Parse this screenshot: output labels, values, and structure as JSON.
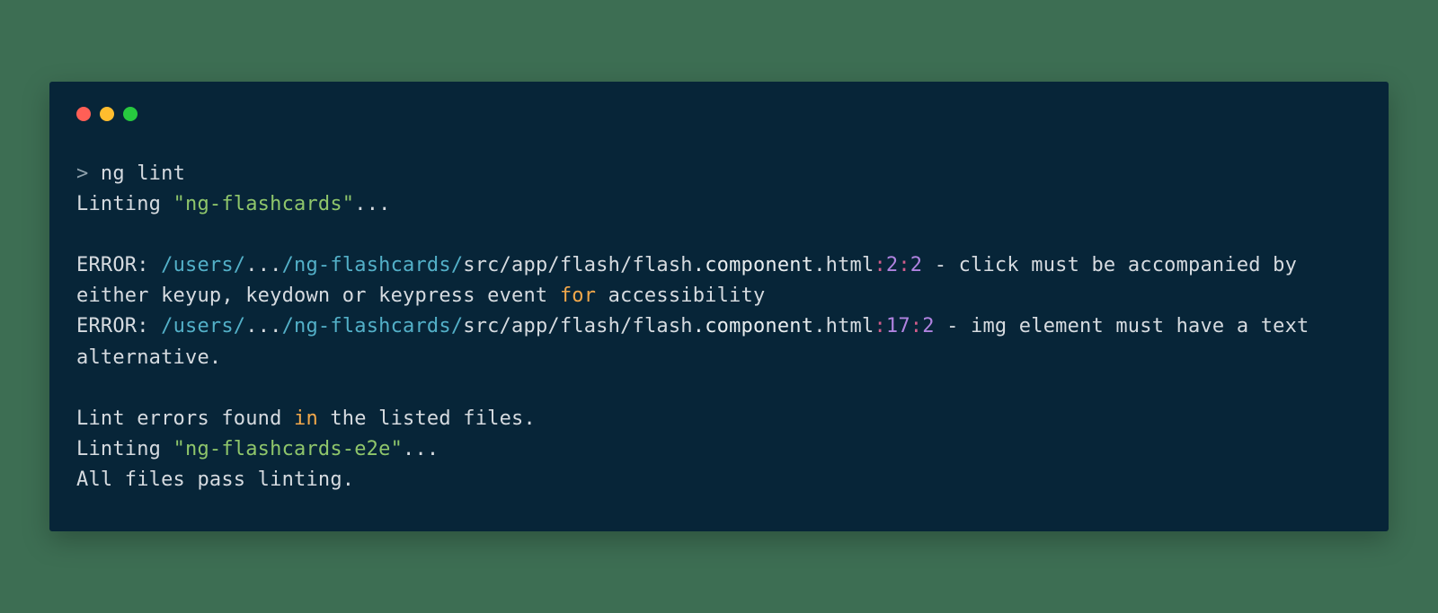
{
  "terminal": {
    "traffic_lights": [
      "close",
      "minimize",
      "zoom"
    ],
    "lines": [
      {
        "segments": [
          {
            "text": "> ",
            "cls": "c-dim"
          },
          {
            "text": "ng ",
            "cls": "c-default"
          },
          {
            "text": "lint",
            "cls": "c-default"
          }
        ]
      },
      {
        "segments": [
          {
            "text": "Linting ",
            "cls": "c-default"
          },
          {
            "text": "\"ng-flashcards\"",
            "cls": "c-green"
          },
          {
            "text": "...",
            "cls": "c-default"
          }
        ]
      },
      {
        "segments": [
          {
            "text": " ",
            "cls": "c-default"
          }
        ]
      },
      {
        "segments": [
          {
            "text": "ERROR: ",
            "cls": "c-default"
          },
          {
            "text": "/users/",
            "cls": "c-cyan"
          },
          {
            "text": "...",
            "cls": "c-default"
          },
          {
            "text": "/ng-flashcards/",
            "cls": "c-cyan"
          },
          {
            "text": "src/app/flash/flash",
            "cls": "c-default"
          },
          {
            "text": ".component",
            "cls": "c-white"
          },
          {
            "text": ".html",
            "cls": "c-default"
          },
          {
            "text": ":",
            "cls": "c-magenta"
          },
          {
            "text": "2",
            "cls": "c-purple"
          },
          {
            "text": ":",
            "cls": "c-magenta"
          },
          {
            "text": "2",
            "cls": "c-purple"
          },
          {
            "text": " - click must be accompanied by either keyup, keydown or keypress event ",
            "cls": "c-default"
          },
          {
            "text": "for",
            "cls": "c-orange"
          },
          {
            "text": " accessibility",
            "cls": "c-default"
          }
        ]
      },
      {
        "segments": [
          {
            "text": "ERROR: ",
            "cls": "c-default"
          },
          {
            "text": "/users/",
            "cls": "c-cyan"
          },
          {
            "text": "...",
            "cls": "c-default"
          },
          {
            "text": "/ng-flashcards/",
            "cls": "c-cyan"
          },
          {
            "text": "src/app/flash/flash",
            "cls": "c-default"
          },
          {
            "text": ".component",
            "cls": "c-white"
          },
          {
            "text": ".html",
            "cls": "c-default"
          },
          {
            "text": ":",
            "cls": "c-magenta"
          },
          {
            "text": "17",
            "cls": "c-purple"
          },
          {
            "text": ":",
            "cls": "c-magenta"
          },
          {
            "text": "2",
            "cls": "c-purple"
          },
          {
            "text": " - img element must have a text alternative.",
            "cls": "c-default"
          }
        ]
      },
      {
        "segments": [
          {
            "text": " ",
            "cls": "c-default"
          }
        ]
      },
      {
        "segments": [
          {
            "text": "Lint errors found ",
            "cls": "c-default"
          },
          {
            "text": "in",
            "cls": "c-orange"
          },
          {
            "text": " the listed files.",
            "cls": "c-default"
          }
        ]
      },
      {
        "segments": [
          {
            "text": "Linting ",
            "cls": "c-default"
          },
          {
            "text": "\"ng-flashcards-e2e\"",
            "cls": "c-green"
          },
          {
            "text": "...",
            "cls": "c-default"
          }
        ]
      },
      {
        "segments": [
          {
            "text": "All files pass linting.",
            "cls": "c-default"
          }
        ]
      }
    ]
  }
}
